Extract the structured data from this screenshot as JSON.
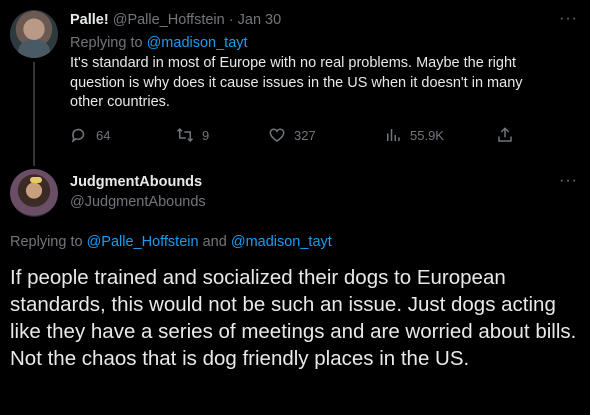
{
  "tweet1": {
    "display_name": "Palle!",
    "handle": "@Palle_Hoffstein",
    "separator": "·",
    "date": "Jan 30",
    "replying_prefix": "Replying to",
    "replying_to": "@madison_tayt",
    "text": "It's standard in most of Europe with no real problems. Maybe the right question is why does it cause issues in the US when it doesn't in many other countries.",
    "more_icon": "more-dots-icon",
    "actions": {
      "replies": "64",
      "retweets": "9",
      "likes": "327",
      "views": "55.9K"
    }
  },
  "tweet2": {
    "display_name": "JudgmentAbounds",
    "handle": "@JudgmentAbounds",
    "replying_prefix": "Replying to",
    "replying_to_1": "@Palle_Hoffstein",
    "replying_and": "and",
    "replying_to_2": "@madison_tayt",
    "text": "If people trained and socialized their dogs to European standards, this would not be such an issue. Just dogs acting like they have a series of meetings and are worried about bills. Not the chaos that is dog friendly places in the US."
  },
  "colors": {
    "background": "#000000",
    "text": "#e7e9ea",
    "muted": "#71767b",
    "link": "#1d9bf0"
  }
}
